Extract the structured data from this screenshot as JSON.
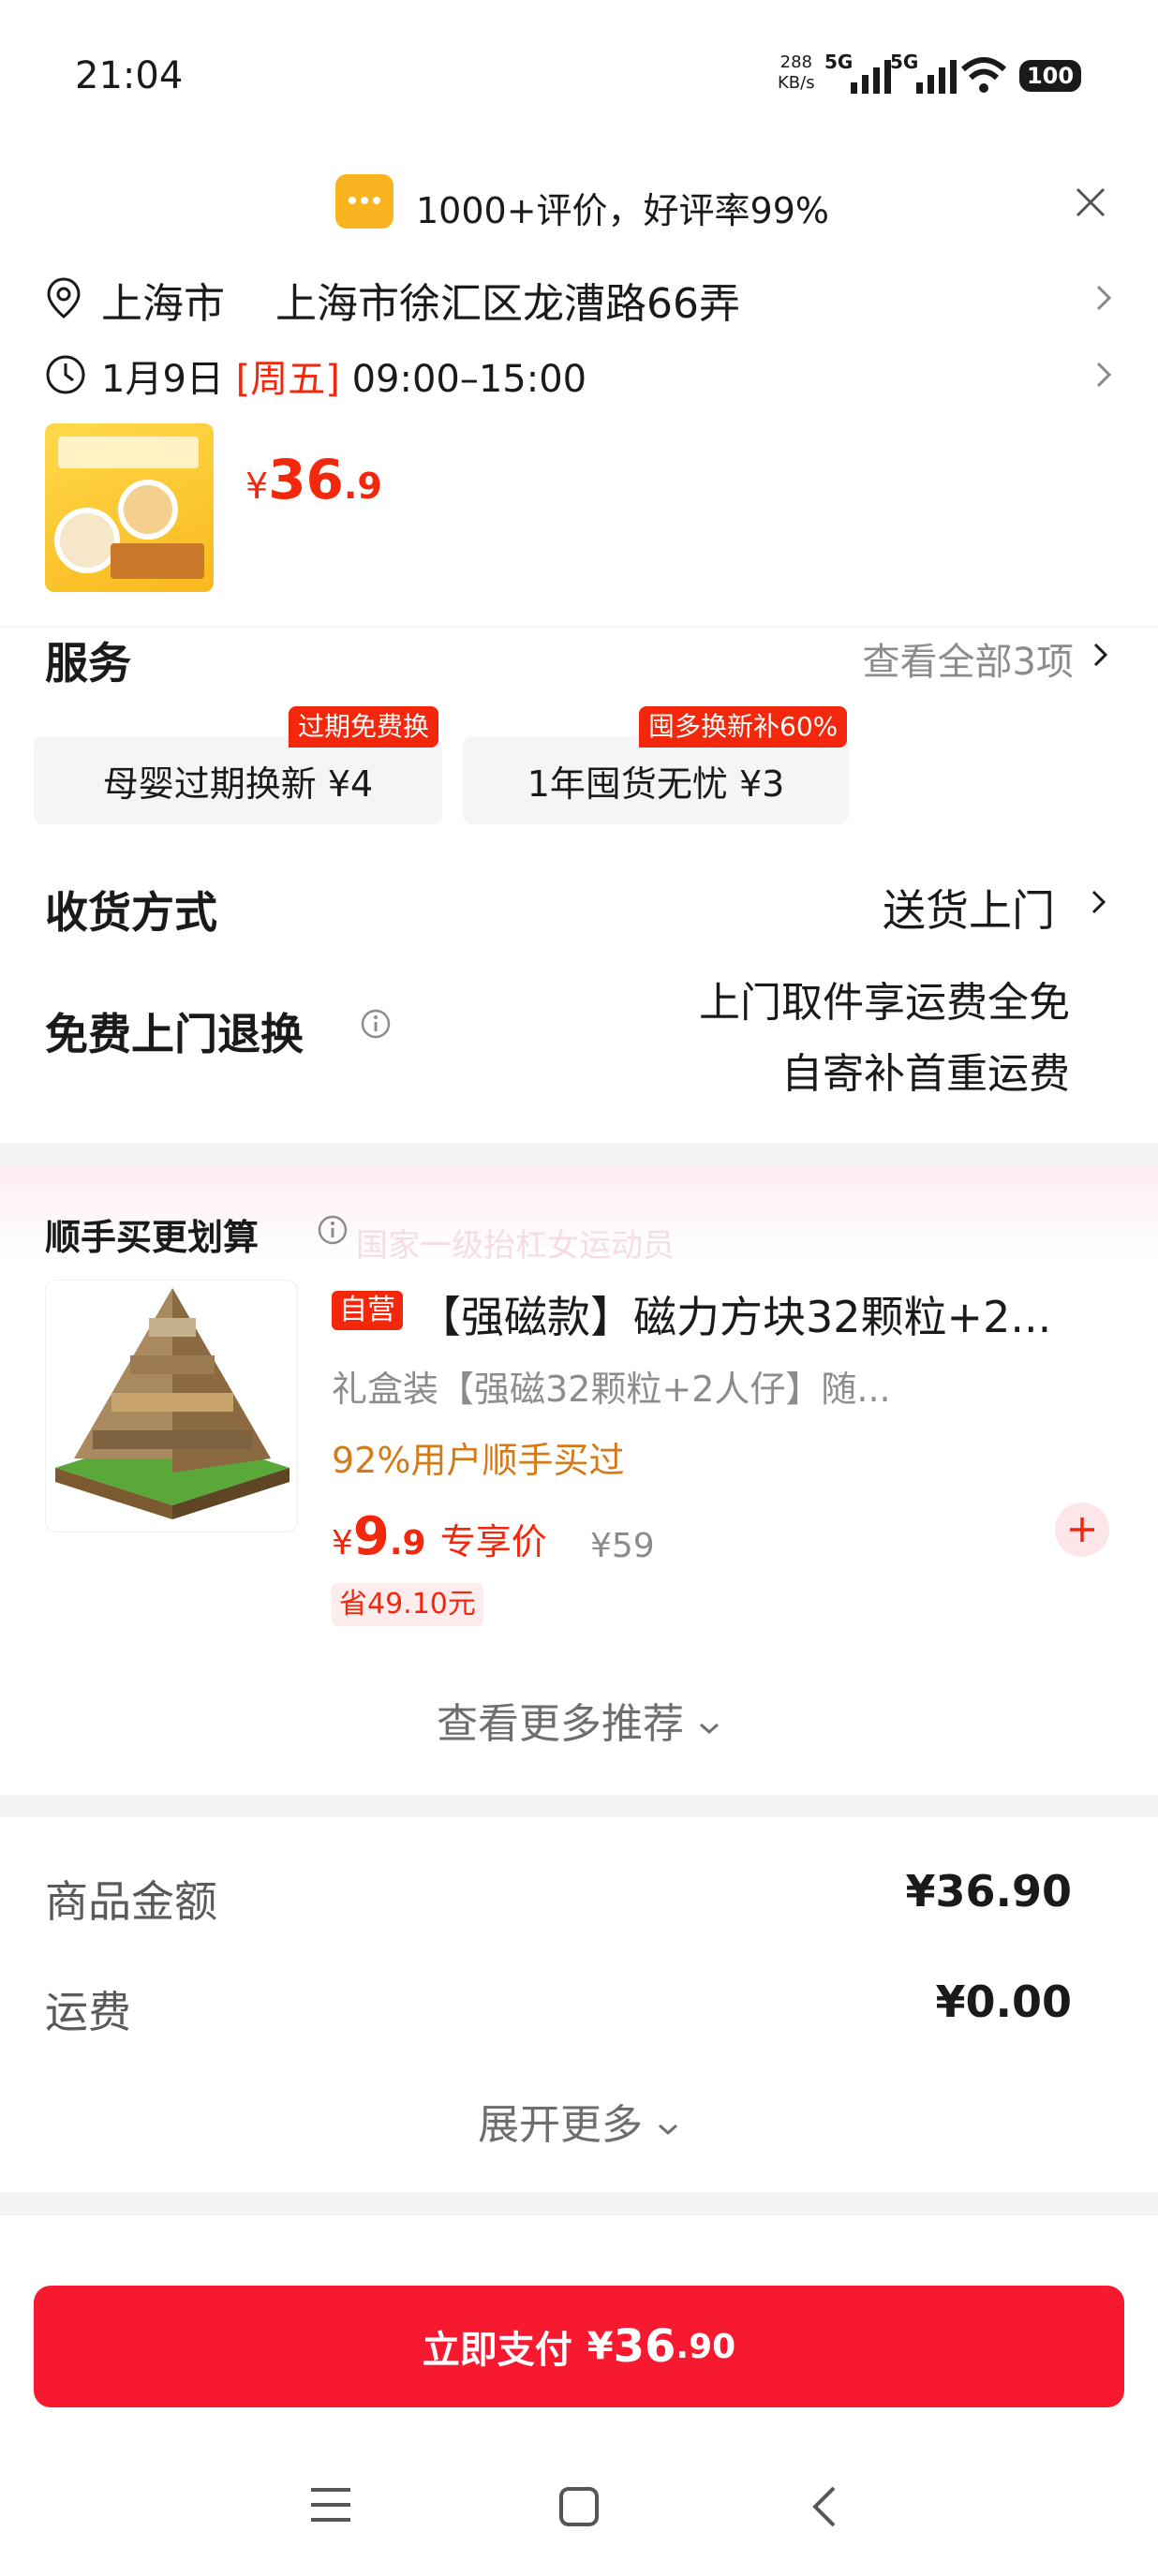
{
  "status_bar": {
    "time": "21:04",
    "net_speed_value": "288",
    "net_speed_unit": "KB/s",
    "sim1_label": "5G",
    "sim2_label": "5G",
    "battery": "100"
  },
  "rating_banner": {
    "icon": "message-bubble-icon",
    "text": "1000+评价，好评率99%"
  },
  "address": {
    "city": "上海市",
    "detail": "上海市徐汇区龙漕路66弄",
    "date": "1月9日",
    "weekday": "[周五]",
    "time_slot": "09:00–15:00"
  },
  "product": {
    "price_symbol": "¥",
    "price_integer": "36",
    "price_decimal": ".9"
  },
  "service": {
    "title": "服务",
    "view_all": "查看全部3项",
    "cards": [
      {
        "label": "母婴过期换新  ¥4",
        "tag": "过期免费换"
      },
      {
        "label": "1年囤货无忧  ¥3",
        "tag": "囤多换新补60%"
      }
    ]
  },
  "delivery": {
    "label": "收货方式",
    "value": "送货上门"
  },
  "return": {
    "label": "免费上门退换",
    "line1": "上门取件享运费全免",
    "line2": "自寄补首重运费"
  },
  "recommend": {
    "title": "顺手买更划算",
    "watermark": "国家一级抬杠女运动员",
    "self_badge": "自营",
    "name": "【强磁款】磁力方块32颗粒+2...",
    "desc": "礼盒装【强磁32颗粒+2人仔】随...",
    "bought": "92%用户顺手买过",
    "price_symbol": "¥",
    "price_integer": "9",
    "price_decimal": ".9",
    "price_label": "专享价",
    "orig_price": "¥59",
    "save": "省49.10元",
    "more": "查看更多推荐"
  },
  "amounts": {
    "goods_label": "商品金额",
    "goods_value": "¥36.90",
    "shipping_label": "运费",
    "shipping_value": "¥0.00",
    "expand": "展开更多"
  },
  "pay": {
    "label": "立即支付",
    "symbol": "¥",
    "integer": "36",
    "decimal": ".90"
  },
  "colors": {
    "accent_red": "#f2270c",
    "pay_red": "#f7192f",
    "orange_text": "#d47a18"
  }
}
